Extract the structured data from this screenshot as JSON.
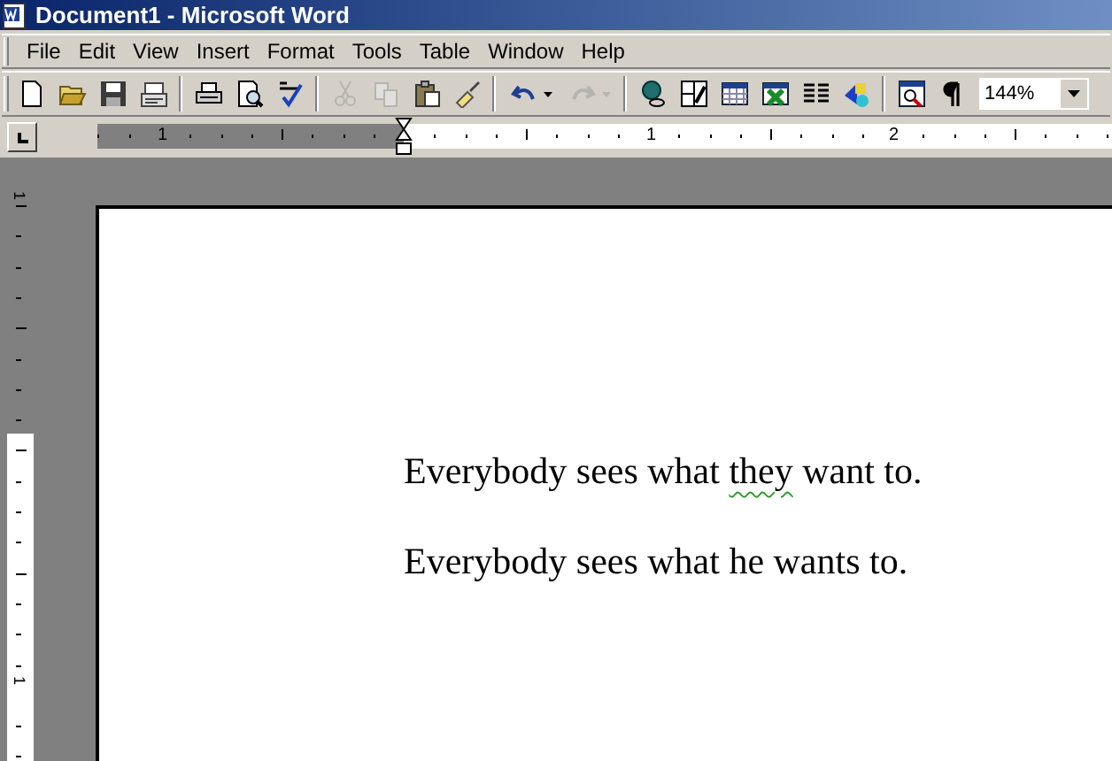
{
  "window": {
    "title": "Document1 - Microsoft Word"
  },
  "menu": [
    {
      "label": "File"
    },
    {
      "label": "Edit"
    },
    {
      "label": "View"
    },
    {
      "label": "Insert"
    },
    {
      "label": "Format"
    },
    {
      "label": "Tools"
    },
    {
      "label": "Table"
    },
    {
      "label": "Window"
    },
    {
      "label": "Help"
    }
  ],
  "toolbar": [
    {
      "kind": "button",
      "disabled": false
    },
    {
      "kind": "button",
      "disabled": false
    },
    {
      "kind": "button",
      "disabled": false
    },
    {
      "kind": "button",
      "disabled": false
    },
    {
      "kind": "separator"
    },
    {
      "kind": "button",
      "disabled": false
    },
    {
      "kind": "button",
      "disabled": false
    },
    {
      "kind": "button",
      "disabled": false
    },
    {
      "kind": "separator"
    },
    {
      "kind": "button",
      "disabled": true
    },
    {
      "kind": "button",
      "disabled": true
    },
    {
      "kind": "button",
      "disabled": false
    },
    {
      "kind": "button",
      "disabled": false
    },
    {
      "kind": "separator"
    },
    {
      "kind": "split",
      "disabled": false
    },
    {
      "kind": "split",
      "disabled": true
    },
    {
      "kind": "separator"
    },
    {
      "kind": "button",
      "disabled": false
    },
    {
      "kind": "button",
      "disabled": false
    },
    {
      "kind": "button",
      "disabled": false
    },
    {
      "kind": "button",
      "disabled": false
    },
    {
      "kind": "button",
      "disabled": false
    },
    {
      "kind": "button",
      "disabled": false
    },
    {
      "kind": "separator"
    },
    {
      "kind": "button",
      "disabled": false
    },
    {
      "kind": "button",
      "disabled": false
    }
  ],
  "zoom": {
    "value": "144%"
  },
  "horizontal_ruler": {
    "labels": [
      "1",
      "1",
      "2"
    ]
  },
  "vertical_ruler": {
    "labels": [
      "1",
      "1"
    ]
  },
  "document": {
    "paragraphs": [
      {
        "runs": [
          {
            "text": "Everybody sees what ",
            "grammar_flag": false
          },
          {
            "text": "they",
            "grammar_flag": true
          },
          {
            "text": " want to.",
            "grammar_flag": false
          }
        ]
      },
      {
        "runs": [
          {
            "text": "Everybody sees what he wants to.",
            "grammar_flag": false
          }
        ]
      }
    ]
  }
}
